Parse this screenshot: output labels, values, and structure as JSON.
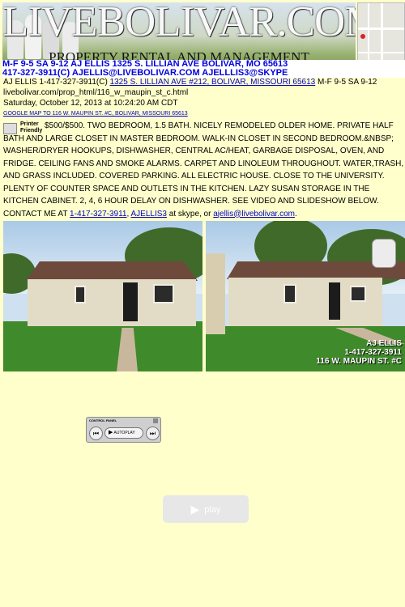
{
  "banner": {
    "title": "LIVEBOLIVAR.COM",
    "subtitle": "PROPERTY RENTAL AND MANAGEMENT",
    "hours_address": "M-F 9-5  SA 9-12  AJ ELLIS  1325 S. LILLIAN AVE BOLIVAR, MO 65613",
    "contacts": "417-327-3911(C)   AJELLIS@LIVEBOLIVAR.COM   AJELLLIS3@SKYPE"
  },
  "header": {
    "contact_prefix": "AJ ELLIS  1-417-327-3911(C) ",
    "address_link": "1325 S. LILLIAN AVE #212, BOLIVAR, MISSOURI 65613",
    "hours_suffix": "  M-F 9-5 SA 9-12",
    "page_url": "livebolivar.com/prop_html/116_w_maupin_st_c.html",
    "datetime": "Saturday, October 12, 2013 at 10:24:20 AM CDT",
    "map_link": "GOOGLE MAP TO 116 W. MAUPIN ST. #C, BOLIVAR, MISSOURI 65613"
  },
  "printer": {
    "line1": "Printer",
    "line2": "Friendly",
    "icon": "printer-icon"
  },
  "listing": {
    "description": "$500/$500.  TWO BEDROOM, 1.5 BATH.  NICELY REMODELED OLDER HOME.  PRIVATE HALF BATH AND LARGE CLOSET IN MASTER BEDROOM.  WALK-IN CLOSET IN SECOND BEDROOM.&NBSP; WASHER/DRYER HOOKUPS, DISHWASHER, CENTRAL AC/HEAT, GARBAGE DISPOSAL, OVEN, AND FRIDGE.  CEILING FANS AND SMOKE ALARMS.  CARPET AND LINOLEUM THROUGHOUT.  WATER,TRASH, AND GRASS INCLUDED.  COVERED PARKING.  ALL ELECTRIC HOUSE.  CLOSE TO THE UNIVERSITY.  PLENTY OF COUNTER SPACE AND OUTLETS IN THE KITCHEN.  LAZY SUSAN STORAGE IN THE KITCHEN CABINET.  2, 4, 6 HOUR DELAY ON DISHWASHER.  SEE VIDEO AND SLIDESHOW BELOW.  CONTACT ME AT ",
    "phone_link": "1-417-327-3911",
    "sep": ", ",
    "skype_link": "AJELLIS3",
    "skype_suffix": " at skype, or",
    "email_link": "ajellis@livebolivar.com",
    "email_suffix": "."
  },
  "photo_caption": {
    "name": "AJ ELLIS",
    "phone": "1-417-327-3911",
    "address": "116 W. MAUPIN ST. #C"
  },
  "slideshow": {
    "title": "CONTROL PANEL",
    "prev_icon": "previous-icon",
    "autoplay_label": "AUTOPLAY",
    "next_icon": "next-icon"
  },
  "video": {
    "play_label": "play"
  },
  "colors": {
    "page_bg": "#ffffcc",
    "banner_text": "#0000dd",
    "link": "#0000cc"
  }
}
